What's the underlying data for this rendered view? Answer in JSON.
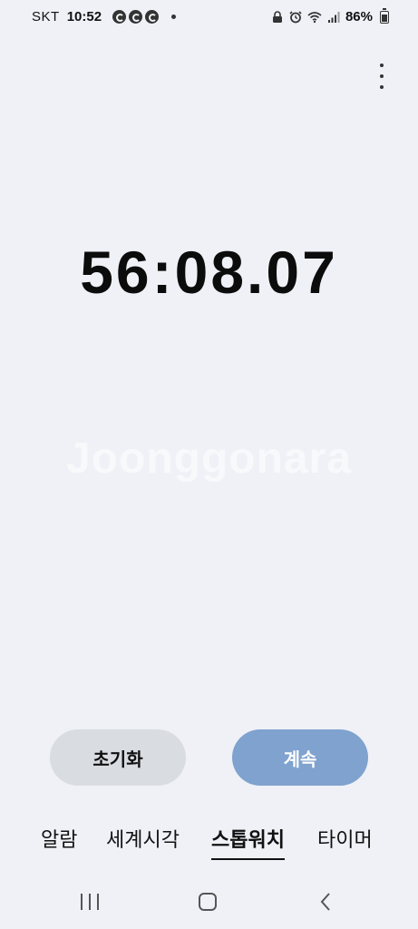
{
  "status_bar": {
    "carrier": "SKT",
    "time": "10:52",
    "battery_percent": "86%",
    "notification_icons": [
      "c-icon",
      "c-icon",
      "c-icon",
      "dot"
    ],
    "system_icons": [
      "lock-icon",
      "alarm-icon",
      "wifi-icon",
      "signal-icon",
      "battery-icon"
    ]
  },
  "menu": {
    "icon": "more-vertical-icon"
  },
  "stopwatch": {
    "elapsed": "56:08.07"
  },
  "watermark": "Joonggonara",
  "buttons": {
    "reset_label": "초기화",
    "resume_label": "계속"
  },
  "tabs": [
    {
      "label": "알람",
      "active": false
    },
    {
      "label": "세계시각",
      "active": false
    },
    {
      "label": "스톱워치",
      "active": true
    },
    {
      "label": "타이머",
      "active": false
    }
  ],
  "colors": {
    "background": "#eff1f7",
    "resume_button": "#7fa2ce",
    "reset_button": "#d9dce1"
  }
}
